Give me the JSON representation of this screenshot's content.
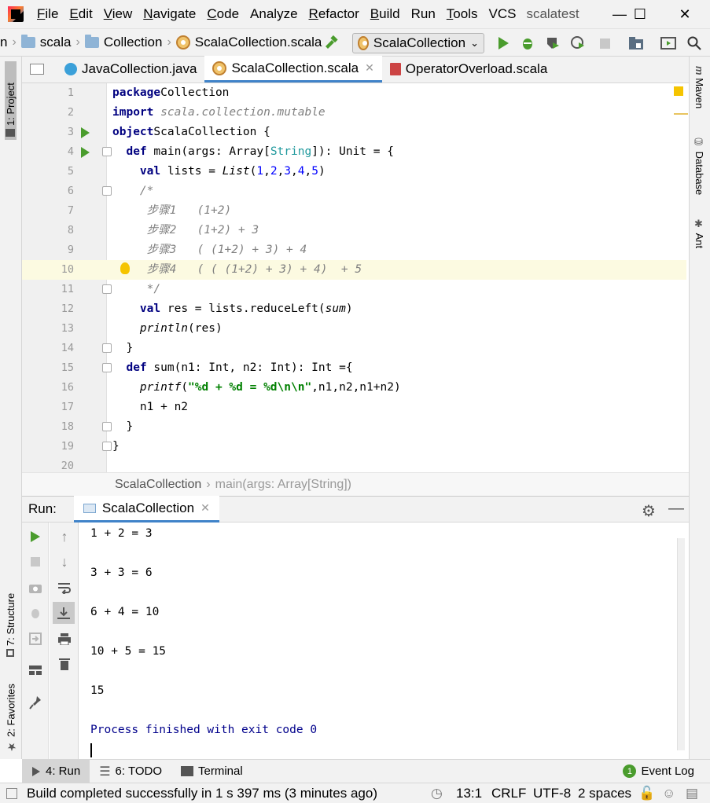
{
  "menubar": {
    "items": [
      {
        "label": "File",
        "mnemonic": "F",
        "rest": "ile"
      },
      {
        "label": "Edit",
        "mnemonic": "E",
        "rest": "dit"
      },
      {
        "label": "View",
        "mnemonic": "V",
        "rest": "iew"
      },
      {
        "label": "Navigate",
        "mnemonic": "N",
        "rest": "avigate"
      },
      {
        "label": "Code",
        "mnemonic": "C",
        "rest": "ode"
      },
      {
        "label": "Analyze",
        "mnemonic": "",
        "rest": "Analyze"
      },
      {
        "label": "Refactor",
        "mnemonic": "R",
        "rest": "efactor"
      },
      {
        "label": "Build",
        "mnemonic": "B",
        "rest": "uild"
      },
      {
        "label": "Run",
        "mnemonic": "",
        "rest": "Run"
      },
      {
        "label": "Tools",
        "mnemonic": "T",
        "rest": "ools"
      },
      {
        "label": "VCS",
        "mnemonic": "",
        "rest": "VCS"
      }
    ],
    "project_title": "scalatest",
    "window_controls": {
      "minimize": "—",
      "maximize": "☐",
      "close": "✕"
    }
  },
  "navbar": {
    "leading": "n",
    "crumbs": [
      "scala",
      "Collection",
      "ScalaCollection.scala"
    ],
    "run_config": "ScalaCollection"
  },
  "left_strip": {
    "project_tab": "1: Project",
    "structure_tab": "7: Structure",
    "favorites_tab": "2: Favorites"
  },
  "right_strip": {
    "maven": "Maven",
    "database": "Database",
    "ant": "Ant"
  },
  "tabs": [
    {
      "label": "JavaCollection.java",
      "active": false,
      "closable": false
    },
    {
      "label": "ScalaCollection.scala",
      "active": true,
      "closable": true
    },
    {
      "label": "OperatorOverload.scala",
      "active": false,
      "closable": false
    }
  ],
  "editor": {
    "current_line": 10,
    "lines": [
      {
        "n": "1",
        "tokens": [
          [
            "kw",
            "package"
          ],
          [
            "",
            "Collection"
          ]
        ]
      },
      {
        "n": "2",
        "tokens": [
          [
            "kw",
            "import"
          ],
          [
            "cm",
            " scala.collection.mutable"
          ]
        ]
      },
      {
        "n": "3",
        "tokens": [
          [
            "kw",
            "object"
          ],
          [
            "",
            "ScalaCollection {"
          ]
        ]
      },
      {
        "n": "4",
        "tokens": [
          [
            "",
            "  "
          ],
          [
            "kw",
            "def"
          ],
          [
            "",
            " main(args: Array["
          ],
          [
            "tp",
            "String"
          ],
          [
            "",
            "]): Unit = {"
          ]
        ]
      },
      {
        "n": "5",
        "tokens": [
          [
            "",
            "    "
          ],
          [
            "kw",
            "val"
          ],
          [
            "",
            " lists = "
          ],
          [
            "it",
            "List"
          ],
          [
            "",
            "("
          ],
          [
            "nm",
            "1"
          ],
          [
            "",
            ","
          ],
          [
            "nm",
            "2"
          ],
          [
            "",
            ","
          ],
          [
            "nm",
            "3"
          ],
          [
            "",
            ","
          ],
          [
            "nm",
            "4"
          ],
          [
            "",
            ","
          ],
          [
            "nm",
            "5"
          ],
          [
            "",
            ")"
          ]
        ]
      },
      {
        "n": "6",
        "tokens": [
          [
            "cm",
            "    /*"
          ]
        ]
      },
      {
        "n": "7",
        "tokens": [
          [
            "cm",
            "     步骤1   (1+2)"
          ]
        ]
      },
      {
        "n": "8",
        "tokens": [
          [
            "cm",
            "     步骤2   (1+2) + 3"
          ]
        ]
      },
      {
        "n": "9",
        "tokens": [
          [
            "cm",
            "     步骤3   ( (1+2) + 3) + 4"
          ]
        ]
      },
      {
        "n": "10",
        "tokens": [
          [
            "cm",
            "     步骤4   ( ( (1+2) + 3) + 4)  + 5"
          ]
        ]
      },
      {
        "n": "11",
        "tokens": [
          [
            "cm",
            "     */"
          ]
        ]
      },
      {
        "n": "12",
        "tokens": [
          [
            "",
            "    "
          ],
          [
            "kw",
            "val"
          ],
          [
            "",
            " res = lists.reduceLeft("
          ],
          [
            "it",
            "sum"
          ],
          [
            "",
            ")"
          ]
        ]
      },
      {
        "n": "13",
        "tokens": [
          [
            "",
            "    "
          ],
          [
            "it",
            "println"
          ],
          [
            "",
            "(res)"
          ]
        ]
      },
      {
        "n": "14",
        "tokens": [
          [
            "",
            "  }"
          ]
        ]
      },
      {
        "n": "15",
        "tokens": [
          [
            "",
            "  "
          ],
          [
            "kw",
            "def"
          ],
          [
            "",
            " sum(n1: Int, n2: Int): Int ={"
          ]
        ]
      },
      {
        "n": "16",
        "tokens": [
          [
            "",
            "    "
          ],
          [
            "it",
            "printf"
          ],
          [
            "",
            "("
          ],
          [
            "str",
            "\"%d + %d = %d\\n\\n\""
          ],
          [
            "",
            ",n1,n2,n1+n2)"
          ]
        ]
      },
      {
        "n": "17",
        "tokens": [
          [
            "",
            "    n1 + n2"
          ]
        ]
      },
      {
        "n": "18",
        "tokens": [
          [
            "",
            "  }"
          ]
        ]
      },
      {
        "n": "19",
        "tokens": [
          [
            "",
            "}"
          ]
        ]
      },
      {
        "n": "20",
        "tokens": []
      }
    ]
  },
  "breadcrumb_bar": {
    "class": "ScalaCollection",
    "method": "main(args: Array[String])"
  },
  "run_panel": {
    "label": "Run:",
    "tab": "ScalaCollection",
    "output": [
      "1 + 2 = 3",
      "",
      "3 + 3 = 6",
      "",
      "6 + 4 = 10",
      "",
      "10 + 5 = 15",
      "",
      "15",
      "",
      "Process finished with exit code 0"
    ]
  },
  "bottom_tabs": {
    "run": "4: Run",
    "todo": "6: TODO",
    "terminal": "Terminal",
    "event_log": "Event Log"
  },
  "status": {
    "message": "Build completed successfully in 1 s 397 ms (3 minutes ago)",
    "position": "13:1",
    "line_sep": "CRLF",
    "encoding": "UTF-8",
    "indent": "2 spaces"
  },
  "colors": {
    "accent": "#4083c9",
    "run_green": "#4a9c2d",
    "current_line": "#fcfae1",
    "keyword": "#000080",
    "number": "#0000ff",
    "string": "#008000",
    "comment": "#808080"
  }
}
